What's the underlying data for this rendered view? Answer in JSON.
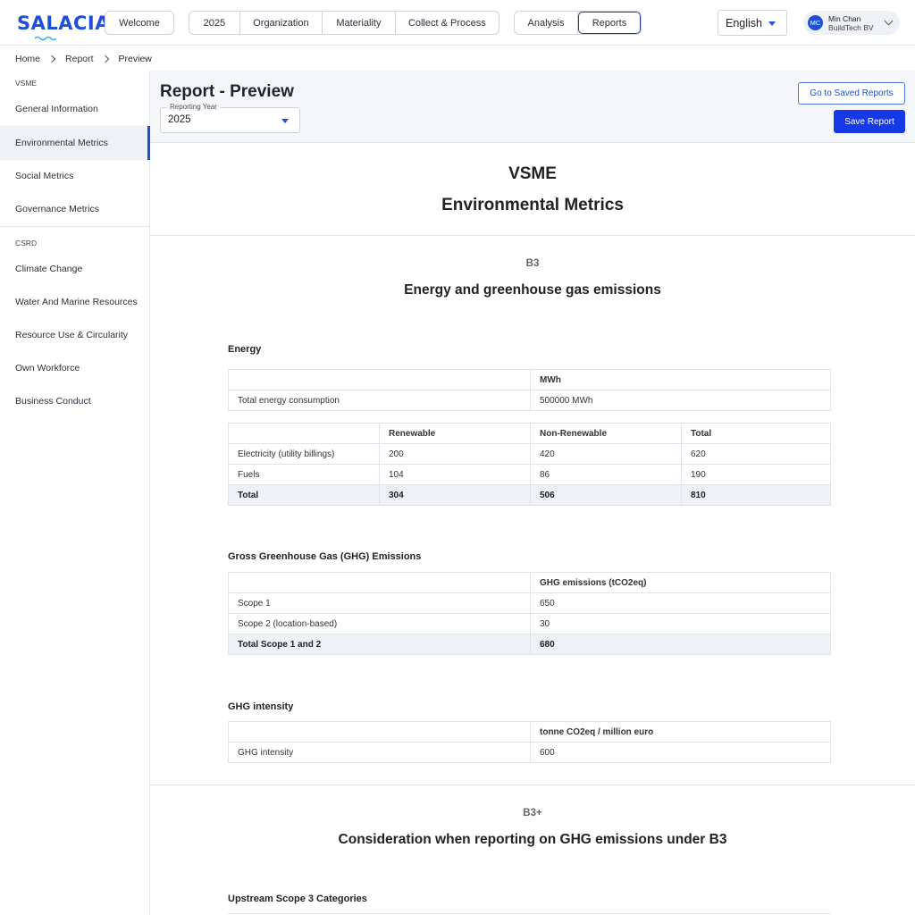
{
  "app": {
    "logo": "SALACIA",
    "nav_welcome": "Welcome",
    "nav_group1": [
      "2025",
      "Organization",
      "Materiality",
      "Collect & Process"
    ],
    "nav_group2": [
      "Analysis",
      "Reports"
    ],
    "language": "English",
    "user": {
      "initials": "MC",
      "name": "Min Chan",
      "org": "BuildTech BV"
    },
    "accent": "#1e4fd8"
  },
  "breadcrumb": [
    "Home",
    "Report",
    "Preview"
  ],
  "sidebar": {
    "groups": [
      {
        "label": "VSME",
        "items": [
          "General Information",
          "Environmental Metrics",
          "Social Metrics",
          "Governance Metrics"
        ]
      },
      {
        "label": "CSRD",
        "items": [
          "Climate Change",
          "Water And Marine Resources",
          "Resource Use & Circularity",
          "Own Workforce",
          "Business Conduct"
        ]
      }
    ],
    "active": "Environmental Metrics"
  },
  "header": {
    "title": "Report - Preview",
    "year_label": "Reporting Year",
    "year_value": "2025",
    "saved_reports": "Go to Saved Reports",
    "save_report": "Save Report"
  },
  "report": {
    "framework": "VSME",
    "category": "Environmental Metrics",
    "section1": {
      "code": "B3",
      "title": "Energy and greenhouse gas emissions",
      "energy": {
        "title": "Energy",
        "unit_header": "MWh",
        "total_label": "Total energy consumption",
        "total_value": "500000 MWh",
        "columns": [
          "",
          "Renewable",
          "Non-Renewable",
          "Total"
        ],
        "rows": [
          [
            "Electricity (utility billings)",
            "200",
            "420",
            "620"
          ],
          [
            "Fuels",
            "104",
            "86",
            "190"
          ]
        ],
        "total_row": [
          "Total",
          "304",
          "506",
          "810"
        ]
      },
      "ghg": {
        "title": "Gross Greenhouse Gas (GHG) Emissions",
        "unit_header": "GHG emissions (tCO2eq)",
        "rows": [
          [
            "Scope 1",
            "650"
          ],
          [
            "Scope 2 (location-based)",
            "30"
          ]
        ],
        "total_row": [
          "Total Scope 1 and 2",
          "680"
        ]
      },
      "intensity": {
        "title": "GHG intensity",
        "unit_header": "tonne CO2eq / million euro",
        "rows": [
          [
            "GHG intensity",
            "600"
          ]
        ]
      }
    },
    "section2": {
      "code": "B3+",
      "title": "Consideration when reporting on GHG emissions under B3",
      "sub": "Upstream Scope 3 Categories"
    }
  }
}
